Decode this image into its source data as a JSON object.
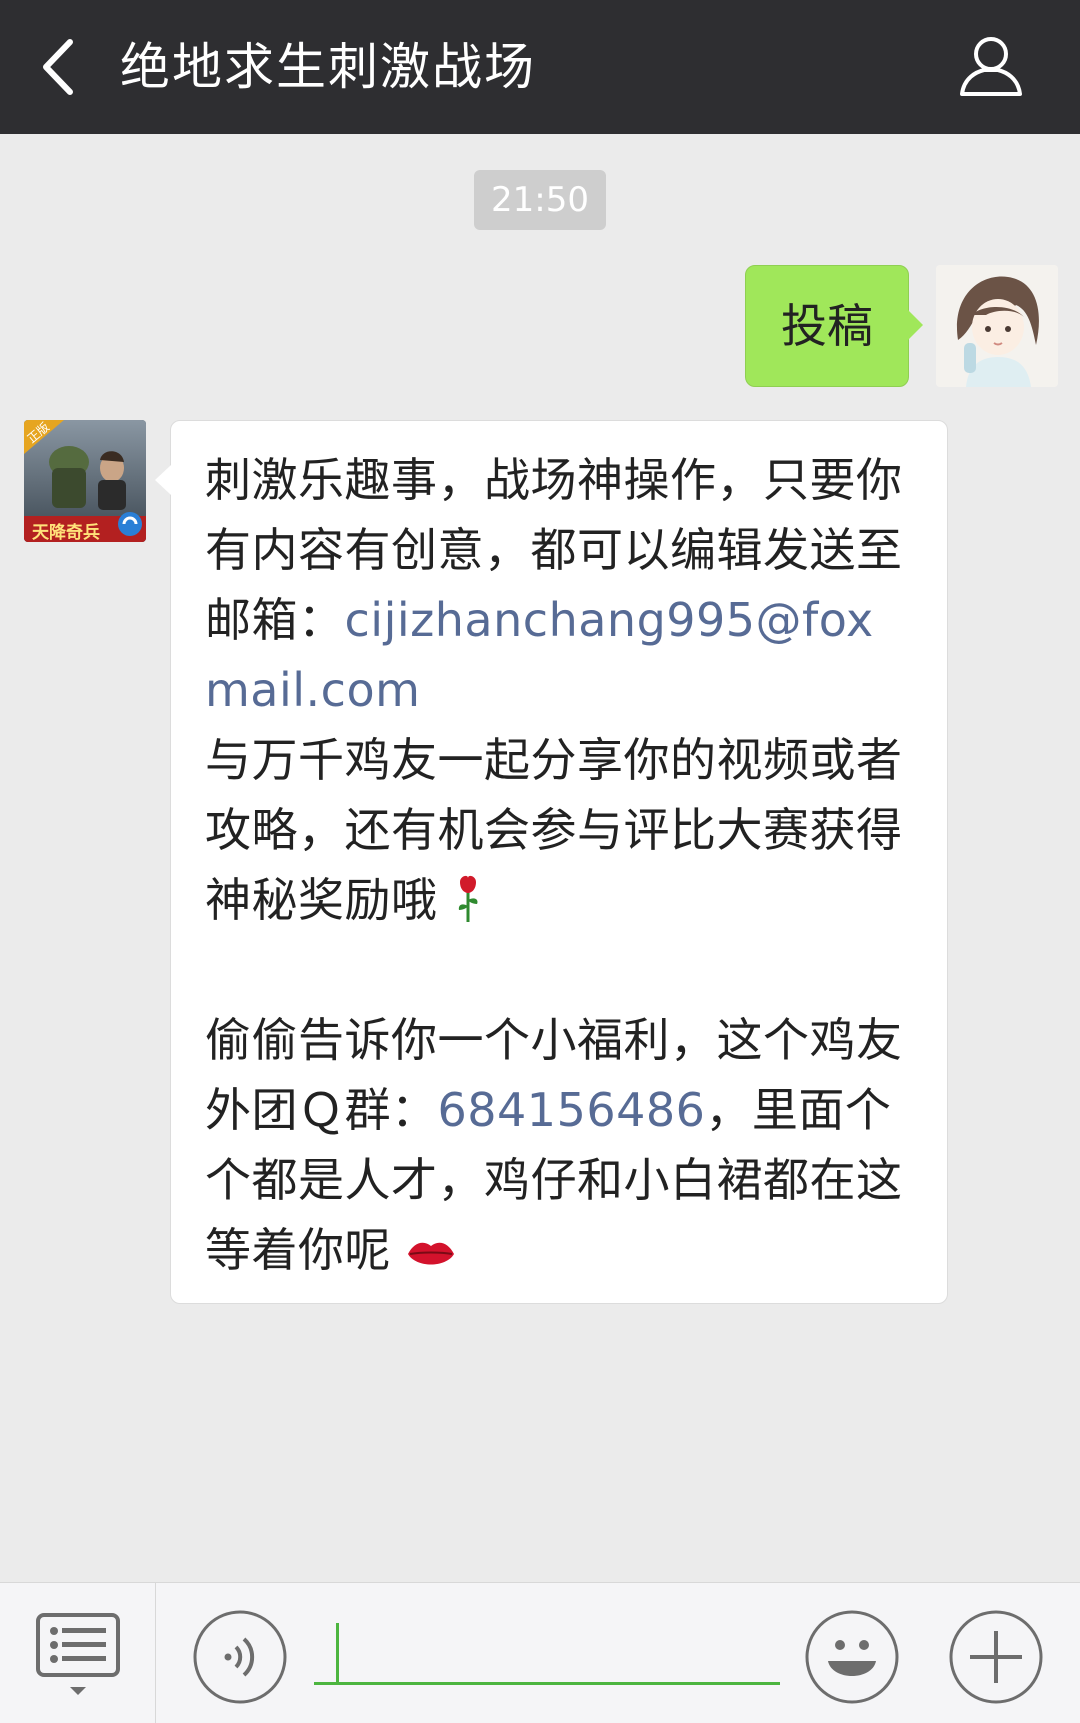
{
  "header": {
    "title": "绝地求生刺激战场",
    "back_icon": "chevron-left-icon",
    "profile_icon": "person-icon"
  },
  "timestamp": "21:50",
  "messages": {
    "outgoing": {
      "text": "投稿"
    },
    "incoming": {
      "line1": "刺激乐趣事，战场神操作，只要你有内容有创意，都可以编辑发送至邮箱：",
      "email": "cijizhanchang995@foxmail.com",
      "line2": "与万千鸡友一起分享你的视频或者攻略，还有机会参与评比大赛获得神秘奖励哦",
      "line3_a": "偷偷告诉你一个小福利，这个鸡友外团Ｑ群：",
      "qq_group": "684156486",
      "line3_b": "，里面个个都是人才，鸡仔和小白裙都在这等着你呢",
      "game_icon_text": "天降奇兵",
      "game_badge_text": "正版"
    }
  },
  "input_bar": {
    "menu_icon": "menu-list-icon",
    "voice_icon": "voice-icon",
    "emoji_icon": "emoji-icon",
    "plus_icon": "plus-icon",
    "input_value": ""
  },
  "colors": {
    "header_bg": "#2e2e31",
    "outgoing_bubble": "#a0e75a",
    "link": "#576b95",
    "input_underline": "#4cb53f"
  }
}
